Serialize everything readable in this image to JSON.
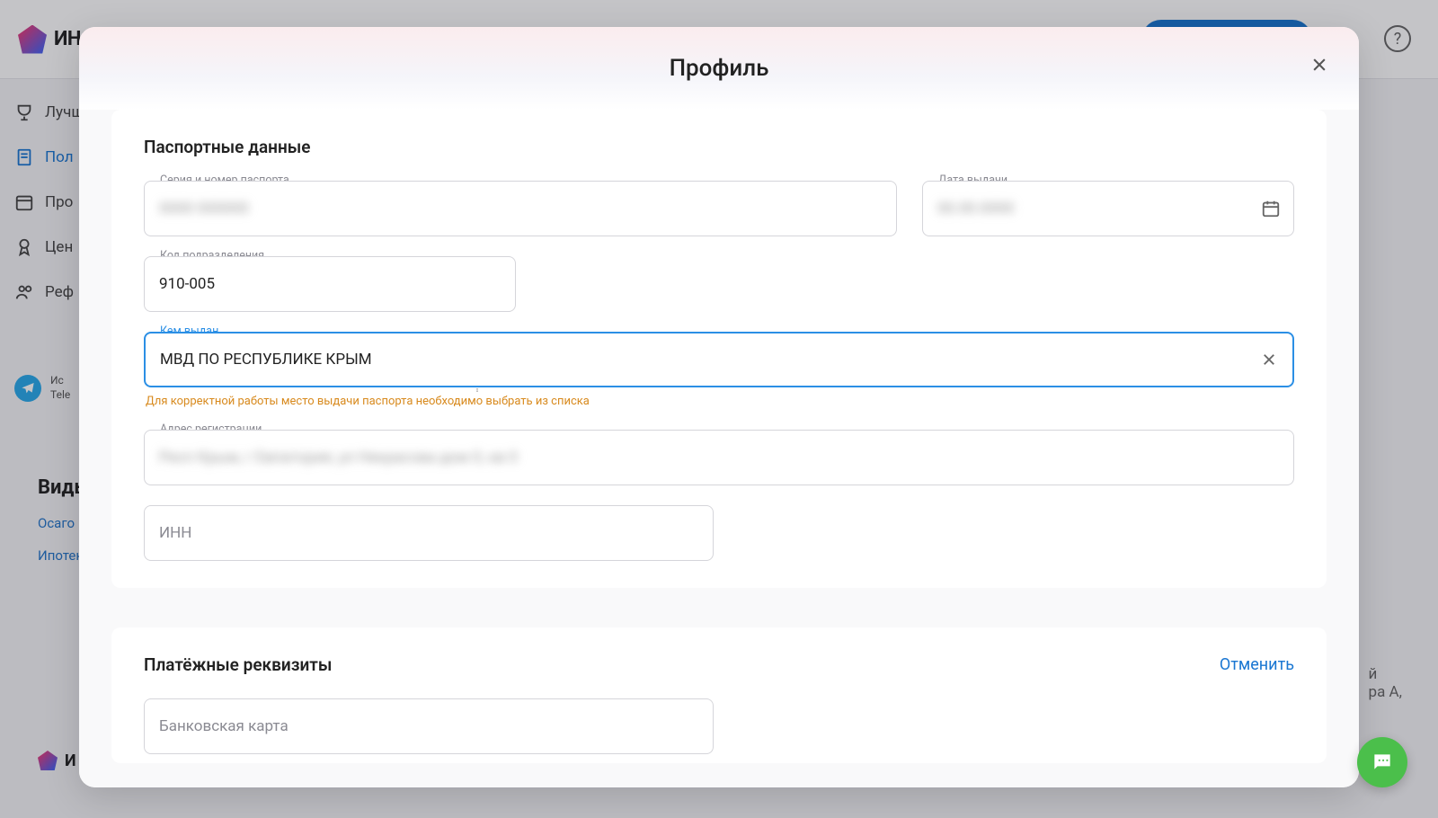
{
  "brand": "ИНССМАРТ",
  "brand_small": "И",
  "header": {
    "help": "?"
  },
  "sidebar": {
    "items": [
      {
        "label": "Лучш"
      },
      {
        "label": "Пол"
      },
      {
        "label": "Про"
      },
      {
        "label": "Цен"
      },
      {
        "label": "Реф"
      }
    ],
    "telegram": {
      "line1": "Ис",
      "line2": "Tele"
    }
  },
  "bottom": {
    "heading": "Виды",
    "links": [
      "Осаго",
      "Ипотек"
    ]
  },
  "right_text": "й\nра А,",
  "modal": {
    "title": "Профиль",
    "sections": {
      "passport": {
        "heading": "Паспортные данные",
        "fields": {
          "series_label": "Серия и номер паспорта",
          "series_value": "0000 000000",
          "date_label": "Дата выдачи",
          "date_value": "00.00.0000",
          "dept_label": "Код подразделения",
          "dept_value": "910-005",
          "issuer_label": "Кем выдан",
          "issuer_value": "МВД ПО РЕСПУБЛИКЕ КРЫМ",
          "issuer_helper": "Для корректной работы место выдачи паспорта необходимо выбрать из списка",
          "address_label": "Адрес регистрации",
          "address_value": "Респ Крым, г Евпатория, ул Некрасова дом 0, кв 0",
          "inn_placeholder": "ИНН"
        }
      },
      "payment": {
        "heading": "Платёжные реквизиты",
        "cancel": "Отменить",
        "card_placeholder": "Банковская карта"
      }
    }
  }
}
